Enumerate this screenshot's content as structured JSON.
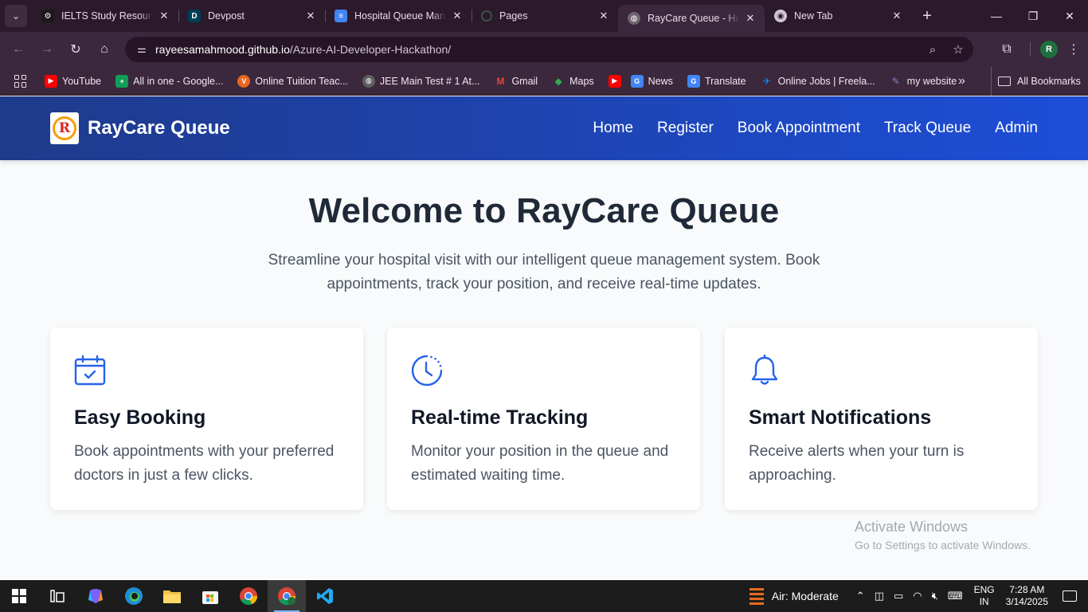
{
  "browser": {
    "tabs": [
      {
        "title": "IELTS Study Resources",
        "color": "#1a1a1a",
        "glyph": "⚙"
      },
      {
        "title": "Devpost",
        "color": "#003e54",
        "glyph": "D"
      },
      {
        "title": "Hospital Queue Mana",
        "color": "#4285f4",
        "glyph": "≡"
      },
      {
        "title": "Pages",
        "color": "#2b1a2c",
        "glyph": "◌"
      },
      {
        "title": "RayCare Queue - Ho",
        "color": "#6f6470",
        "glyph": "◍"
      },
      {
        "title": "New Tab",
        "color": "#2b1a2c",
        "glyph": "◉"
      }
    ],
    "address": {
      "host": "rayeesamahmood.github.io",
      "path": "/Azure-AI-Developer-Hackathon/"
    },
    "profile_initial": "R",
    "bookmarks": [
      {
        "label": "YouTube",
        "color": "#ff0000",
        "glyph": "▶"
      },
      {
        "label": "All in one - Google...",
        "color": "#0f9d58",
        "glyph": "+"
      },
      {
        "label": "Online Tuition Teac...",
        "color": "#e8661f",
        "glyph": "V"
      },
      {
        "label": "JEE Main Test # 1 At...",
        "color": "#5f5f5f",
        "glyph": "◍"
      },
      {
        "label": "Gmail",
        "color": "#ea4335",
        "glyph": "M"
      },
      {
        "label": "Maps",
        "color": "#34a853",
        "glyph": "◆"
      },
      {
        "label": "",
        "color": "#ff0000",
        "glyph": "▶"
      },
      {
        "label": "News",
        "color": "#4285f4",
        "glyph": "G"
      },
      {
        "label": "Translate",
        "color": "#4285f4",
        "glyph": "G"
      },
      {
        "label": "Online Jobs | Freela...",
        "color": "#1e88e5",
        "glyph": "✈"
      },
      {
        "label": "my website",
        "color": "#3f51b5",
        "glyph": "✎"
      }
    ],
    "all_bookmarks": "All Bookmarks"
  },
  "site": {
    "brand": "RayCare Queue",
    "logo_letter": "R",
    "nav": [
      "Home",
      "Register",
      "Book Appointment",
      "Track Queue",
      "Admin"
    ],
    "hero_title": "Welcome to RayCare Queue",
    "hero_subtitle": "Streamline your hospital visit with our intelligent queue management system. Book appointments, track your position, and receive real-time updates.",
    "features": [
      {
        "title": "Easy Booking",
        "text": "Book appointments with your preferred doctors in just a few clicks.",
        "icon": "calendar-check-icon"
      },
      {
        "title": "Real-time Tracking",
        "text": "Monitor your position in the queue and estimated waiting time.",
        "icon": "clock-icon"
      },
      {
        "title": "Smart Notifications",
        "text": "Receive alerts when your turn is approaching.",
        "icon": "bell-icon"
      }
    ],
    "accent": "#1d4ed8"
  },
  "watermark": {
    "line1": "Activate Windows",
    "line2": "Go to Settings to activate Windows."
  },
  "taskbar": {
    "weather": "Air: Moderate",
    "lang_1": "ENG",
    "lang_2": "IN",
    "time": "7:28 AM",
    "date": "3/14/2025"
  }
}
